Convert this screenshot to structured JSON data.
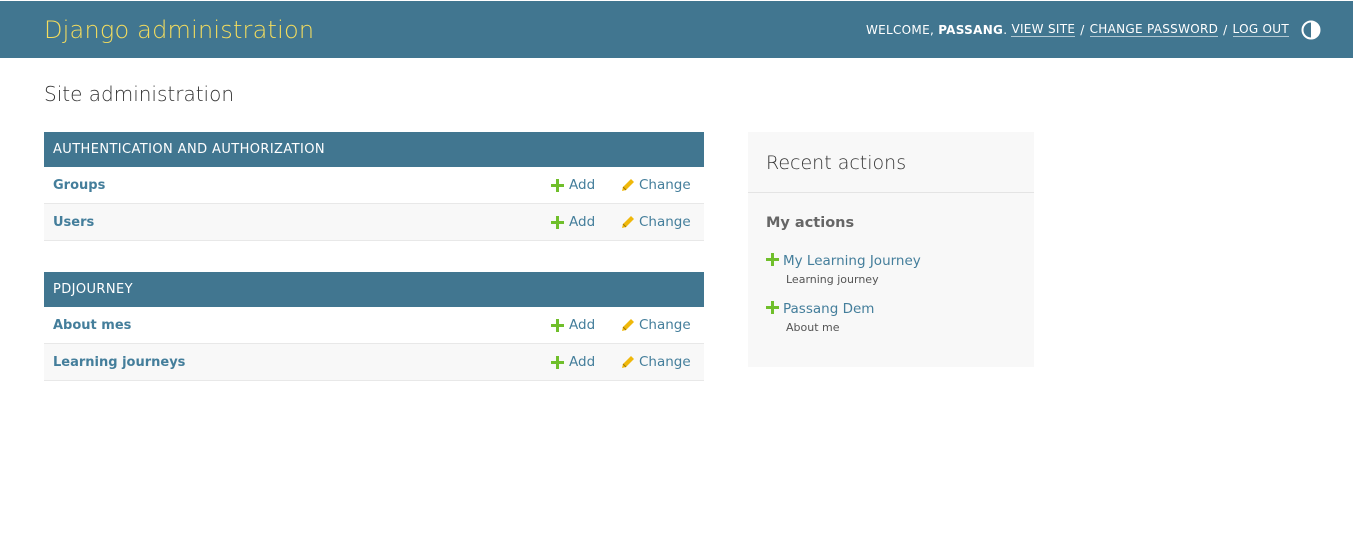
{
  "header": {
    "brand": "Django administration",
    "welcome": "WELCOME,",
    "username": "PASSANG",
    "period": ".",
    "view_site": "VIEW SITE",
    "change_password": "CHANGE PASSWORD",
    "log_out": "LOG OUT",
    "separator": "/",
    "theme_icon": "contrast-icon"
  },
  "page": {
    "title": "Site administration"
  },
  "modules": [
    {
      "caption": "AUTHENTICATION AND AUTHORIZATION",
      "models": [
        {
          "name": "Groups",
          "add": "Add",
          "change": "Change"
        },
        {
          "name": "Users",
          "add": "Add",
          "change": "Change"
        }
      ]
    },
    {
      "caption": "PDJOURNEY",
      "models": [
        {
          "name": "About mes",
          "add": "Add",
          "change": "Change"
        },
        {
          "name": "Learning journeys",
          "add": "Add",
          "change": "Change"
        }
      ]
    }
  ],
  "recent": {
    "title": "Recent actions",
    "subtitle": "My actions",
    "items": [
      {
        "label": "My Learning Journey",
        "type": "Learning journey",
        "icon": "add-icon"
      },
      {
        "label": "Passang Dem",
        "type": "About me",
        "icon": "add-icon"
      }
    ]
  },
  "colors": {
    "header_bg": "#417690",
    "brand": "#f5dd5d",
    "link": "#447e9b",
    "add_icon": "#70bf2b",
    "change_icon": "#efb80b"
  }
}
